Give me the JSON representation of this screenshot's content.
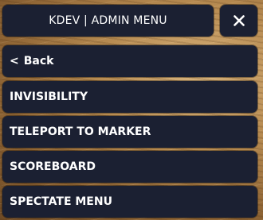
{
  "header": {
    "title": "KDEV | ADMIN MENU",
    "close_icon": "close-icon"
  },
  "back": {
    "chevron": "<",
    "label": "Back"
  },
  "menu": {
    "items": [
      {
        "label": "INVISIBILITY"
      },
      {
        "label": "TELEPORT TO MARKER"
      },
      {
        "label": "SCOREBOARD"
      },
      {
        "label": "SPECTATE MENU"
      }
    ]
  },
  "colors": {
    "panel": "#1b2032",
    "text": "#ffffff"
  }
}
